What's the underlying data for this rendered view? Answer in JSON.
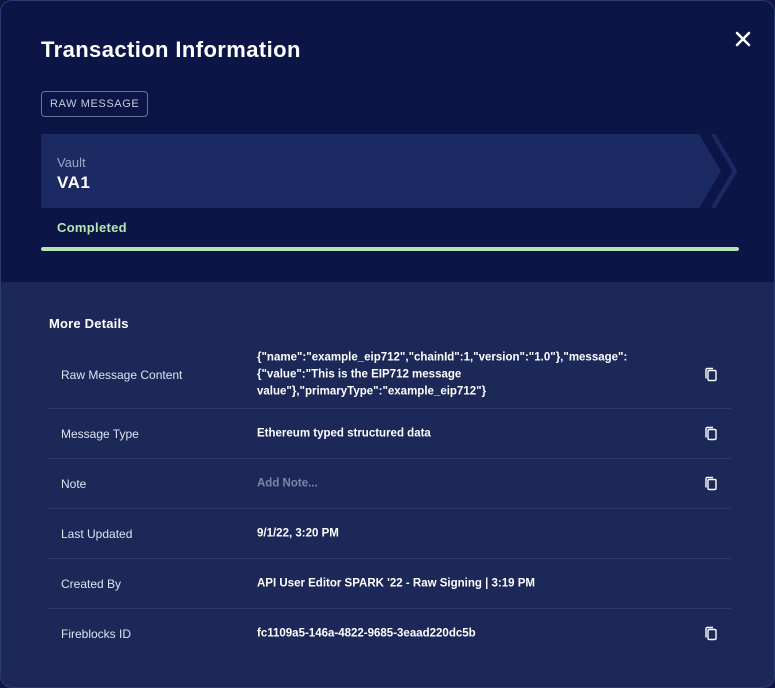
{
  "dialog": {
    "title": "Transaction Information",
    "raw_message_badge": "RAW MESSAGE"
  },
  "vault": {
    "label": "Vault",
    "name": "VA1"
  },
  "status": {
    "text": "Completed",
    "progress": 1.0,
    "color": "#b6e6b0"
  },
  "details": {
    "heading": "More Details",
    "rows": [
      {
        "label": "Raw Message Content",
        "value": "{\"name\":\"example_eip712\",\"chainId\":1,\"version\":\"1.0\"},\"message\":{\"value\":\"This is the EIP712 message value\"},\"primaryType\":\"example_eip712\"}",
        "copy_icon": "copy-icon"
      },
      {
        "label": "Message Type",
        "value": "Ethereum typed structured data",
        "copy_icon": "copy-icon"
      },
      {
        "label": "Note",
        "placeholder": "Add Note...",
        "copy_icon": "copy-icon"
      },
      {
        "label": "Last Updated",
        "value": "9/1/22, 3:20 PM"
      },
      {
        "label": "Created By",
        "value": "API User Editor SPARK '22 - Raw Signing | 3:19 PM"
      },
      {
        "label": "Fireblocks ID",
        "value": "fc1109a5-146a-4822-9685-3eaad220dc5b",
        "copy_icon": "copy-icon"
      }
    ]
  },
  "colors": {
    "header_bg": "#0b1647",
    "body_bg": "#1b2858",
    "accent_green": "#b6e6b0"
  },
  "icons": {
    "close": "close-icon",
    "copy": "copy-icon"
  }
}
